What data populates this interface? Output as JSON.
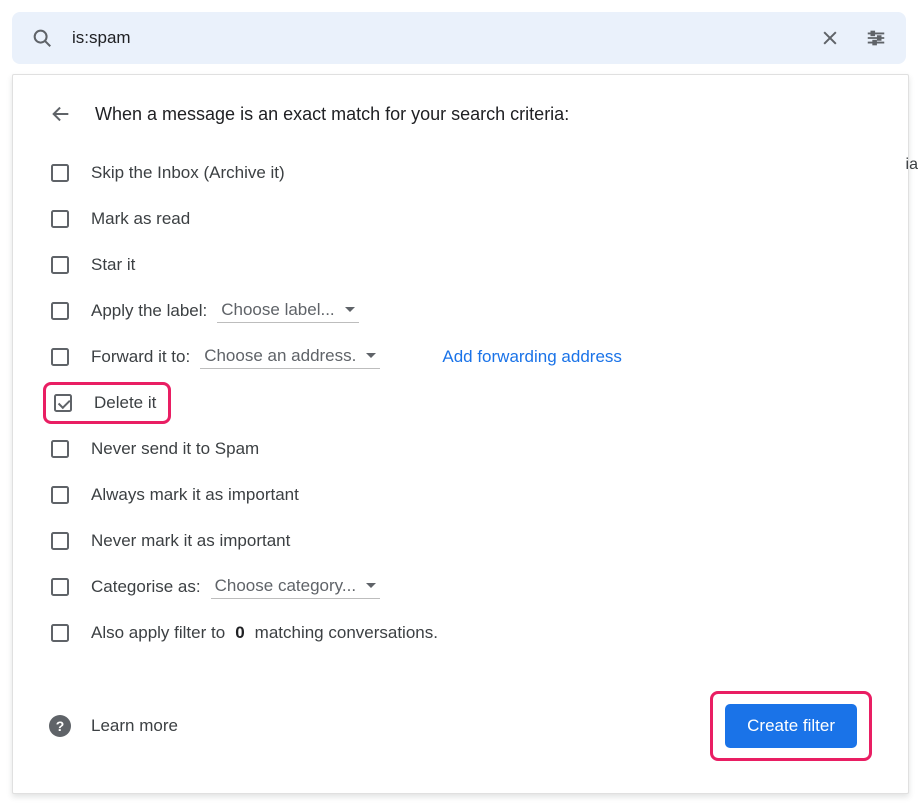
{
  "search": {
    "value": "is:spam"
  },
  "panel": {
    "heading": "When a message is an exact match for your search criteria:"
  },
  "options": {
    "skip_inbox": "Skip the Inbox (Archive it)",
    "mark_as_read": "Mark as read",
    "star_it": "Star it",
    "apply_label_prefix": "Apply the label:",
    "apply_label_dropdown": "Choose label...",
    "forward_prefix": "Forward it to:",
    "forward_dropdown": "Choose an address.",
    "forward_link": "Add forwarding address",
    "delete_it": "Delete it",
    "never_spam": "Never send it to Spam",
    "always_important": "Always mark it as important",
    "never_important": "Never mark it as important",
    "categorise_prefix": "Categorise as:",
    "categorise_dropdown": "Choose category...",
    "also_apply_pre": "Also apply filter to ",
    "also_apply_count": "0",
    "also_apply_post": " matching conversations."
  },
  "footer": {
    "learn_more": "Learn more",
    "create_filter": "Create filter"
  },
  "edge": "ia"
}
